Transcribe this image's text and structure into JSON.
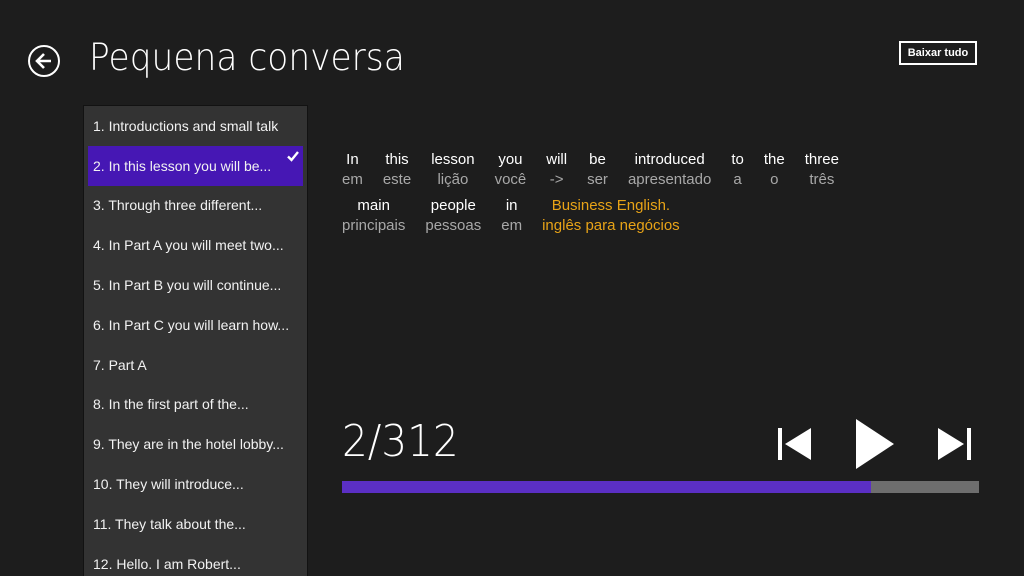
{
  "header": {
    "title": "Pequena conversa",
    "back_icon": "back-arrow-circle-icon",
    "download_all_label": "Baixar tudo"
  },
  "lessons": {
    "selected_index": 1,
    "items": [
      {
        "label": "1. Introductions and small talk"
      },
      {
        "label": "2. In this lesson you will be..."
      },
      {
        "label": "3. Through three different..."
      },
      {
        "label": "4. In Part A you will meet two..."
      },
      {
        "label": "5. In Part B you will continue..."
      },
      {
        "label": "6. In Part C you will learn how..."
      },
      {
        "label": "7. Part A"
      },
      {
        "label": "8. In the first part of the..."
      },
      {
        "label": "9. They are in the hotel lobby..."
      },
      {
        "label": "10. They will introduce..."
      },
      {
        "label": "11. They talk about the..."
      },
      {
        "label": "12. Hello. I am Robert..."
      }
    ]
  },
  "sentence": {
    "rows": [
      [
        {
          "en": "In",
          "pt": "em"
        },
        {
          "en": "this",
          "pt": "este"
        },
        {
          "en": "lesson",
          "pt": "lição"
        },
        {
          "en": "you",
          "pt": "você"
        },
        {
          "en": "will",
          "pt": "->"
        },
        {
          "en": "be",
          "pt": "ser"
        },
        {
          "en": "introduced",
          "pt": "apresentado"
        },
        {
          "en": "to",
          "pt": "a"
        },
        {
          "en": "the",
          "pt": "o"
        },
        {
          "en": "three",
          "pt": "três"
        }
      ],
      [
        {
          "en": "main",
          "pt": "principais"
        },
        {
          "en": "people",
          "pt": "pessoas"
        },
        {
          "en": "in",
          "pt": "em"
        },
        {
          "en": "Business English.",
          "pt": "inglês para negócios",
          "highlight": true
        }
      ]
    ],
    "highlight_color": "#e8a317"
  },
  "player": {
    "counter": "2/312",
    "current": 2,
    "total": 312,
    "progress_fraction": 0.83,
    "prev_icon": "skip-previous-icon",
    "play_icon": "play-icon",
    "next_icon": "skip-next-icon",
    "accent_color": "#5b2fc4"
  }
}
